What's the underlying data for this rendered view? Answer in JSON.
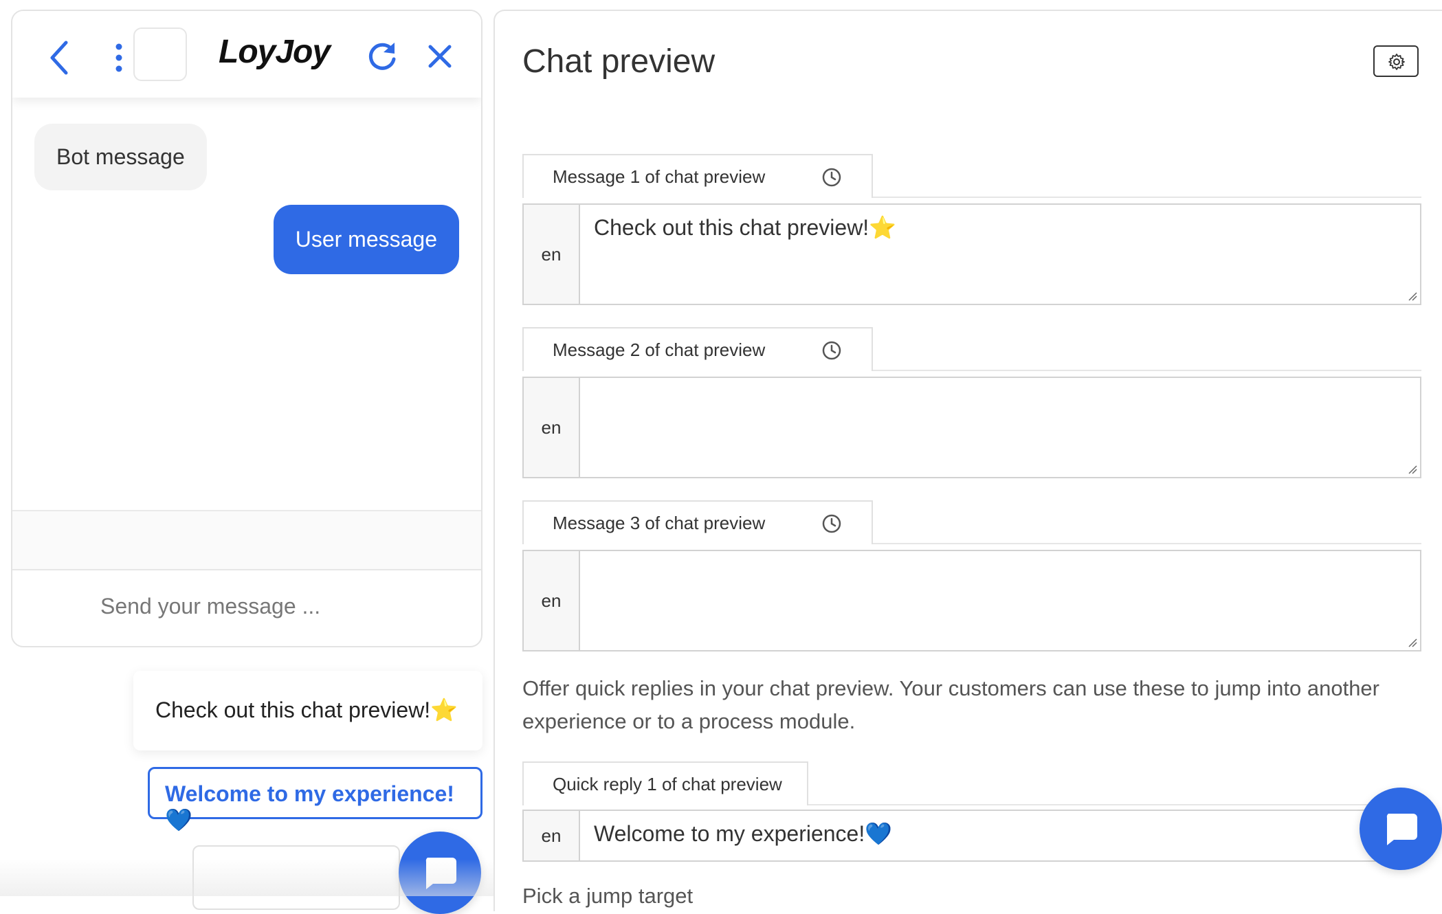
{
  "widget": {
    "brand": "LoyJoy",
    "bot_message": "Bot message",
    "user_message": "User message",
    "input_placeholder": "Send your message ...",
    "preview_card_text": "Check out this chat preview!⭐",
    "quick_reply_button": "Welcome to my experience!💙",
    "accent_color": "#2f6ae5"
  },
  "editor": {
    "title": "Chat preview",
    "messages": [
      {
        "tab": "Message 1 of chat preview",
        "lang": "en",
        "value": "Check out this chat preview!⭐"
      },
      {
        "tab": "Message 2 of chat preview",
        "lang": "en",
        "value": ""
      },
      {
        "tab": "Message 3 of chat preview",
        "lang": "en",
        "value": ""
      }
    ],
    "help_text": "Offer quick replies in your chat preview. Your customers can use these to jump into another experience or to a process module.",
    "quick_reply": {
      "tab": "Quick reply 1 of chat preview",
      "lang": "en",
      "value": "Welcome to my experience!💙"
    },
    "cut_label": "Pick a jump target"
  },
  "icons": [
    "back-icon",
    "more-vertical-icon",
    "refresh-icon",
    "close-icon",
    "settings-gear-icon",
    "clock-icon",
    "chat-bubble-icon"
  ]
}
